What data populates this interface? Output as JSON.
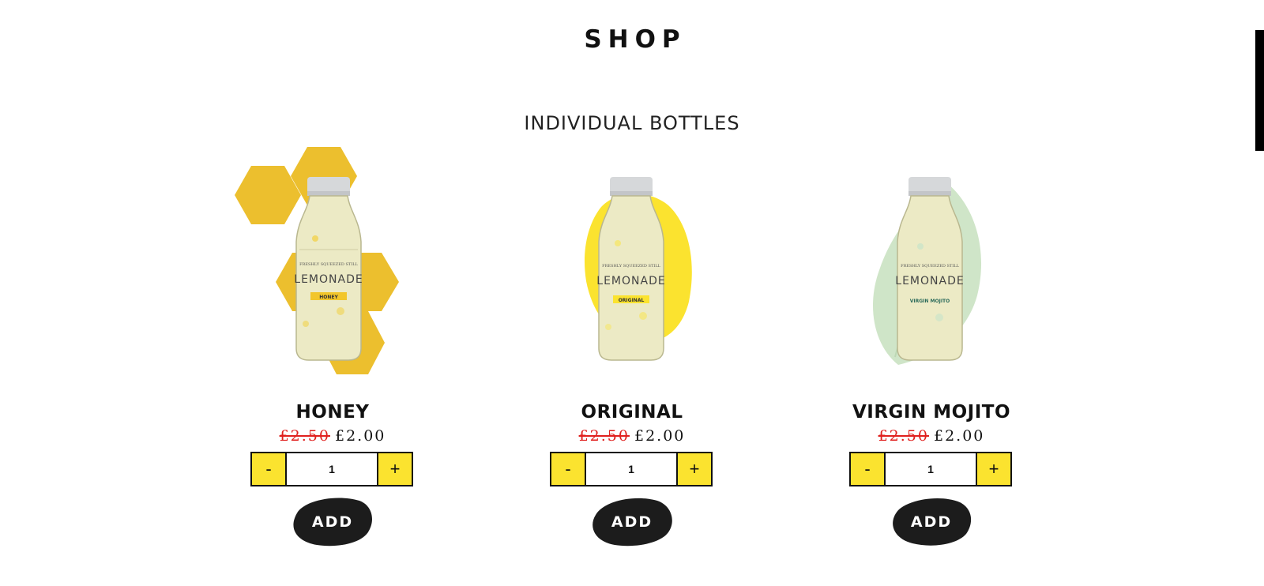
{
  "header": {
    "title": "SHOP"
  },
  "section": {
    "title": "INDIVIDUAL BOTTLES"
  },
  "colors": {
    "accent_yellow": "#fbe32f",
    "sale_red": "#e0201e",
    "honey_gold": "#ecbf2e",
    "mint_green": "#cfe5c8"
  },
  "products": [
    {
      "name": "HONEY",
      "old_price": "£2.50",
      "new_price": "£2.00",
      "quantity": "1",
      "minus_label": "-",
      "plus_label": "+",
      "add_label": "ADD",
      "bottle_label": "LEMONADE",
      "bottle_tagline": "FRESHLY SQUEEZED STILL",
      "flavor_tag": "HONEY",
      "decoration": "honeycomb-hexagons"
    },
    {
      "name": "ORIGINAL",
      "old_price": "£2.50",
      "new_price": "£2.00",
      "quantity": "1",
      "minus_label": "-",
      "plus_label": "+",
      "add_label": "ADD",
      "bottle_label": "LEMONADE",
      "bottle_tagline": "FRESHLY SQUEEZED STILL",
      "flavor_tag": "ORIGINAL",
      "decoration": "lemon-slice"
    },
    {
      "name": "VIRGIN MOJITO",
      "old_price": "£2.50",
      "new_price": "£2.00",
      "quantity": "1",
      "minus_label": "-",
      "plus_label": "+",
      "add_label": "ADD",
      "bottle_label": "LEMONADE",
      "bottle_tagline": "FRESHLY SQUEEZED STILL",
      "flavor_tag": "VIRGIN MOJITO",
      "decoration": "mint-leaf"
    }
  ]
}
